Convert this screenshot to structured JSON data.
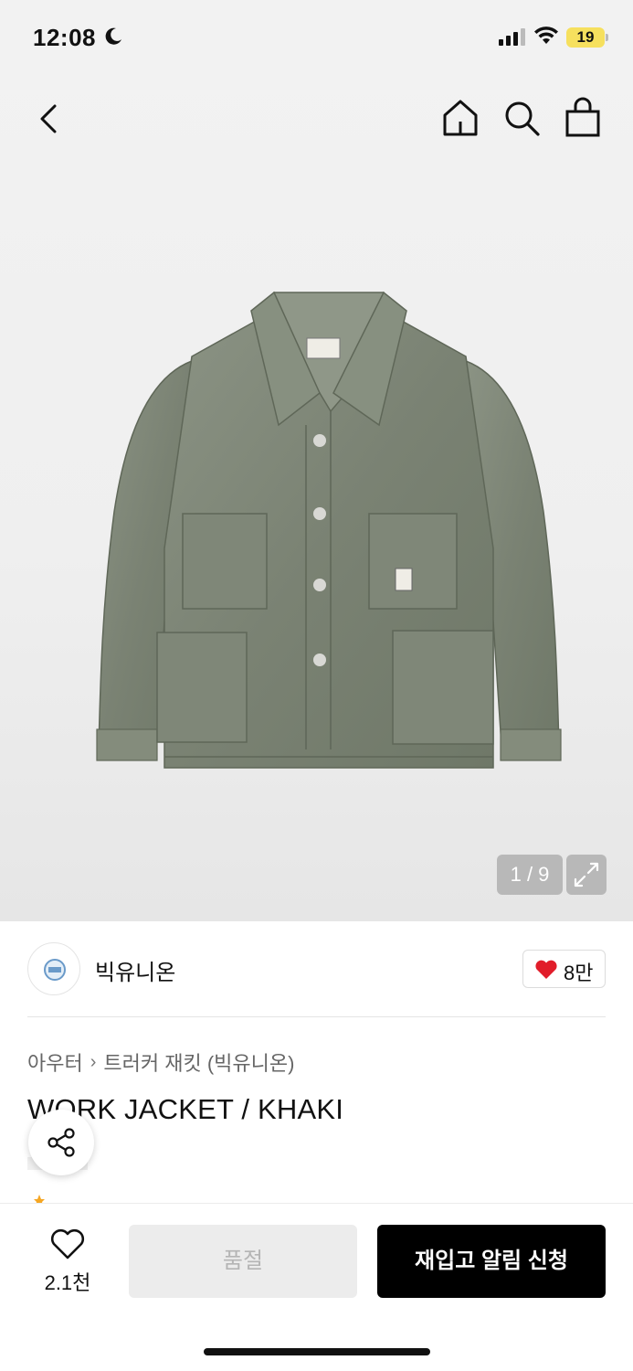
{
  "status_bar": {
    "time": "12:08",
    "battery": "19",
    "battery_color": "#f6e05e"
  },
  "nav": {
    "back_icon": "chevron-left-icon",
    "home_icon": "home-icon",
    "search_icon": "search-icon",
    "bag_icon": "shopping-bag-icon"
  },
  "gallery": {
    "counter": "1 / 9",
    "expand_icon": "expand-icon",
    "product_image": "khaki washed canvas work jacket"
  },
  "brand": {
    "name": "빅유니온",
    "likes": "8만",
    "heart_color": "#e11d2a"
  },
  "product": {
    "breadcrumb": [
      {
        "label": "아우터"
      },
      {
        "label": "트러커 재킷 (빅유니온)"
      }
    ],
    "title": "WORK JACKET / KHAKI"
  },
  "actions": {
    "wish_count": "2.1천",
    "soldout_label": "품절",
    "restock_label": "재입고 알림 신청"
  }
}
